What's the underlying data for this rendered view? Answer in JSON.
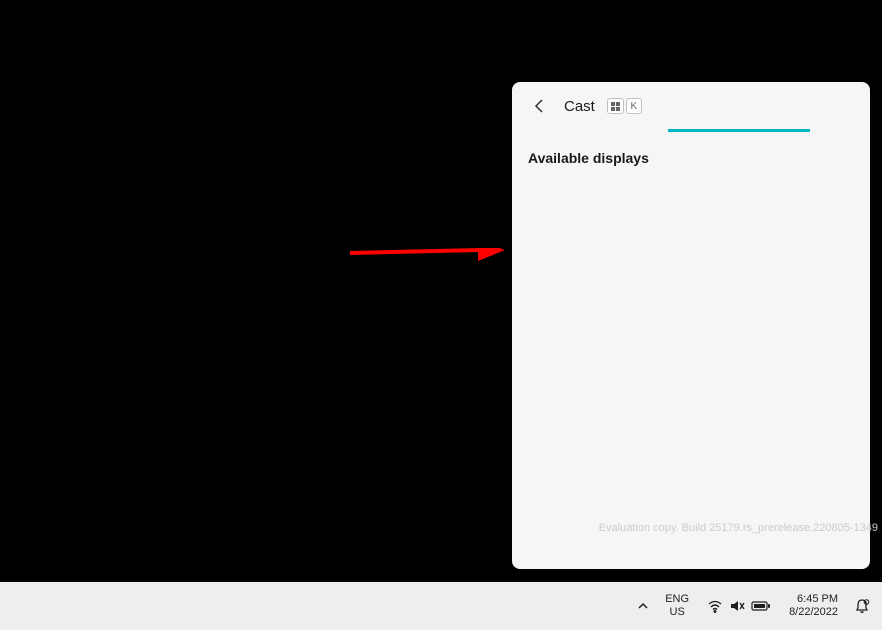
{
  "cast": {
    "title": "Cast",
    "shortcut_key1": "⊞",
    "shortcut_key2": "K",
    "section": "Available displays"
  },
  "watermark": "Evaluation copy. Build 25179.rs_prerelease.220805-1349",
  "taskbar": {
    "lang1": "ENG",
    "lang2": "US",
    "time": "6:45 PM",
    "date": "8/22/2022"
  }
}
